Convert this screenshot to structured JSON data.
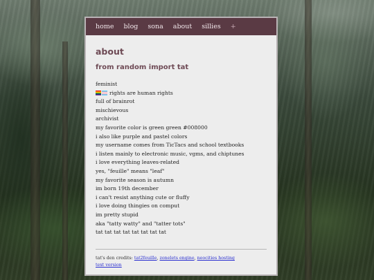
{
  "nav": {
    "items": [
      "home",
      "blog",
      "sona",
      "about",
      "sillies",
      "+"
    ]
  },
  "page": {
    "title": "about",
    "subtitle": "from random import tat"
  },
  "facts": {
    "line1": "feminist",
    "line2": "rights are human rights",
    "line3": "full of brainrot",
    "line4": "mischievous",
    "line5": "archivist",
    "line6": "my favorite color is green green #008000",
    "line7": "i also like purple and pastel colors",
    "line8": "my username comes from TicTacs and school textbooks",
    "line9": "i listen mainly to electronic music, vgms, and chiptunes",
    "line10": "i love everything leaves-related",
    "line11": "yes, \"feuille\" means \"leaf\"",
    "line12": "my favorite season is autumn",
    "line13": "im born 19th december",
    "line14": "i can't resist anything cute or fluffy",
    "line15": "i love doing thingies on comput",
    "line16": "im pretty stupid",
    "line17": "aka \"tatty watty\" and \"tatter tots\"",
    "line18": "tat tat tat tat tat tat tat tat"
  },
  "footer": {
    "credits_prefix": "tat's den credits:",
    "link1": "tat2feuille",
    "sep1": ",",
    "link2": "zonelets engine",
    "sep2": ",",
    "link3": "neocities hosting",
    "text_version": "text version"
  },
  "colors": {
    "nav_bg": "#5a3a44",
    "heading": "#6e4a55",
    "panel_bg": "#ededed",
    "link": "#2a2fd0"
  }
}
